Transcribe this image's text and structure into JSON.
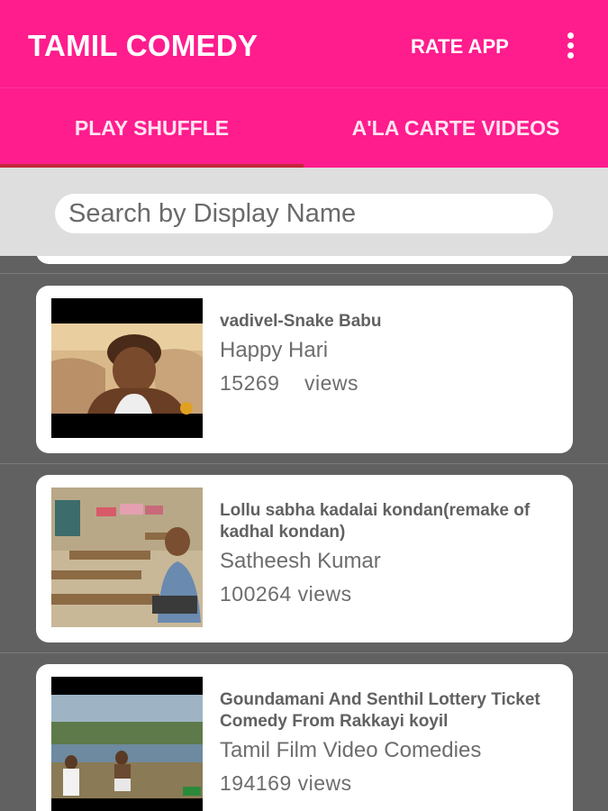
{
  "app": {
    "title": "TAMIL COMEDY",
    "rate_label": "RATE APP",
    "menu_icon": "more-vert-icon",
    "accent_color": "#ff1c8d"
  },
  "tabs": [
    {
      "label": "PLAY SHUFFLE",
      "selected": true
    },
    {
      "label": "A'LA CARTE VIDEOS",
      "selected": false
    }
  ],
  "search": {
    "placeholder": "Search by Display Name",
    "value": ""
  },
  "videos": [
    {
      "title": "vadivel-Snake Babu",
      "channel": "Happy Hari",
      "views": "15269",
      "views_label": "views"
    },
    {
      "title": "Lollu sabha kadalai kondan(remake of kadhal kondan)",
      "channel": "Satheesh Kumar",
      "views": "100264",
      "views_label": "views"
    },
    {
      "title": "Goundamani And Senthil Lottery Ticket Comedy From Rakkayi koyil",
      "channel": "Tamil Film Video Comedies",
      "views": "194169",
      "views_label": "views"
    }
  ]
}
